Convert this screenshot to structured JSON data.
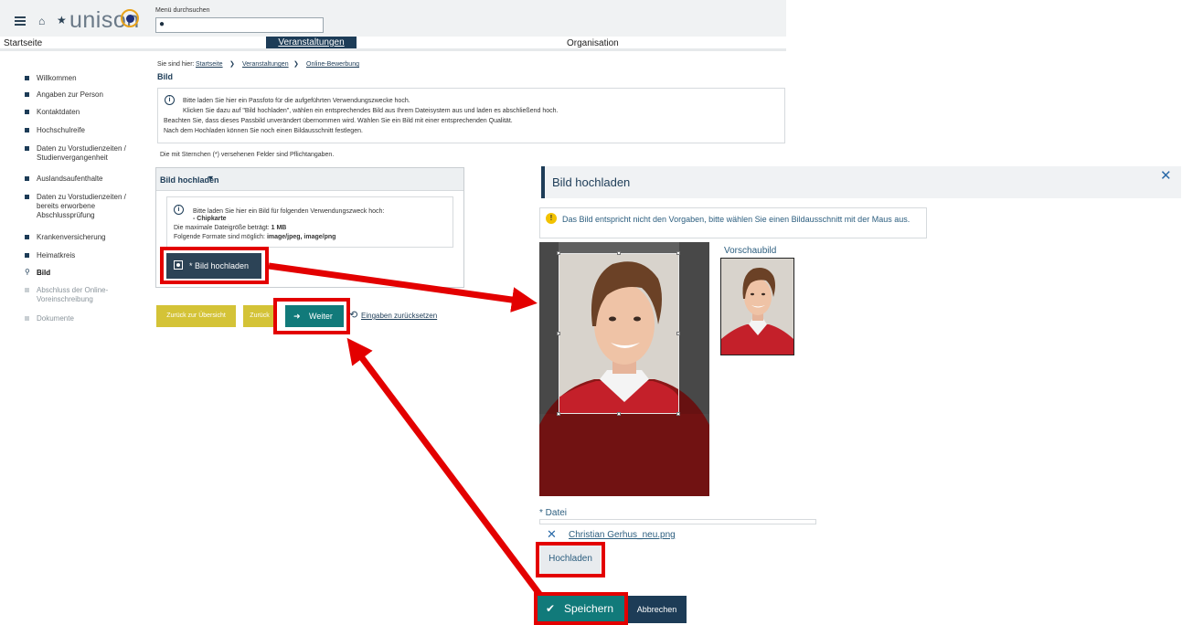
{
  "header": {
    "logo_text": "unison",
    "menu_search_label": "Menü durchsuchen",
    "menu_search_value": ""
  },
  "nav": {
    "items": [
      "Startseite",
      "Veranstaltungen",
      "Organisation"
    ],
    "active": "Veranstaltungen"
  },
  "sidebar": {
    "items": [
      {
        "label": "Willkommen",
        "state": "normal"
      },
      {
        "label": "Angaben zur Person",
        "state": "normal"
      },
      {
        "label": "Kontaktdaten",
        "state": "normal"
      },
      {
        "label": "Hochschulreife",
        "state": "normal"
      },
      {
        "label": "Daten zu Vorstudienzeiten / Studienvergangenheit",
        "state": "normal"
      },
      {
        "label": "Auslandsaufenthalte",
        "state": "normal"
      },
      {
        "label": "Daten zu Vorstudienzeiten / bereits erworbene Abschlussprüfung",
        "state": "normal"
      },
      {
        "label": "Krankenversicherung",
        "state": "normal"
      },
      {
        "label": "Heimatkreis",
        "state": "normal"
      },
      {
        "label": "Bild",
        "state": "active"
      },
      {
        "label": "Abschluss der Online-Voreinschreibung",
        "state": "disabled"
      },
      {
        "label": "Dokumente",
        "state": "disabled"
      }
    ]
  },
  "breadcrumb": {
    "label": "Sie sind hier:",
    "items": [
      "Startseite",
      "Veranstaltungen",
      "Online-Bewerbung"
    ]
  },
  "page": {
    "title": "Bild",
    "info_lines": [
      "Bitte laden Sie hier ein Passfoto für die aufgeführten Verwendungszwecke hoch.",
      "Klicken Sie dazu auf \"Bild hochladen\", wählen ein entsprechendes Bild aus Ihrem Dateisystem aus und laden es abschließend hoch.",
      "Beachten Sie, dass dieses Passbild unverändert übernommen wird. Wählen Sie ein Bild mit einer entsprechenden Qualität.",
      "Nach dem Hochladen können Sie noch einen Bildausschnitt festlegen."
    ],
    "required_note": "Die mit Sternchen (*) versehenen Felder sind Pflichtangaben."
  },
  "upload_section": {
    "header": "Bild hochladen",
    "info_line1": "Bitte laden Sie hier ein Bild für folgenden Verwendungszweck hoch:",
    "purpose": "- Chipkarte",
    "max_size_label": "Die maximale Dateigröße beträgt:",
    "max_size_value": "1 MB",
    "formats_label": "Folgende Formate sind möglich:",
    "formats_value": "image/jpeg, image/png",
    "button_label": "* Bild hochladen"
  },
  "actions": {
    "back_overview": "Zurück zur Übersicht",
    "back": "Zurück",
    "next": "Weiter",
    "reset": "Eingaben zurücksetzen"
  },
  "dialog": {
    "title": "Bild hochladen",
    "warning": "Das Bild entspricht nicht den Vorgaben, bitte wählen Sie einen Bildausschnitt mit der Maus aus.",
    "preview_label": "Vorschaubild",
    "file_label": "* Datei",
    "file_name": "Christian Gerhus_neu.png",
    "upload_button": "Hochladen",
    "save_button": "Speichern",
    "cancel_button": "Abbrechen"
  },
  "colors": {
    "navy": "#1d3c57",
    "teal": "#117a7a",
    "yellow": "#d4c337",
    "highlight_red": "#e30000",
    "logo_orange": "#e8a21b"
  },
  "icons": [
    "hamburger-menu-icon",
    "home-icon",
    "star-icon",
    "search-icon",
    "chevron-right-icon",
    "info-icon",
    "chevron-down-icon",
    "image-icon",
    "arrow-right-icon",
    "reset-icon",
    "close-icon",
    "warning-icon",
    "remove-file-icon",
    "check-icon",
    "location-pin-icon"
  ]
}
